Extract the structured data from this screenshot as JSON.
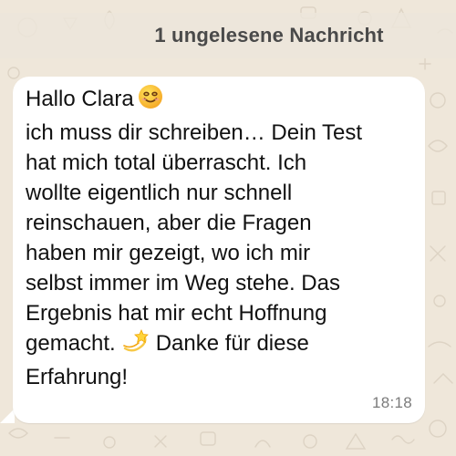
{
  "banner": {
    "unread_label": "1 ungelesene Nachricht"
  },
  "message": {
    "lines": [
      "Hallo Clara",
      "ich muss dir schreiben… Dein Test",
      "hat mich total überrascht. Ich",
      "wollte eigentlich nur schnell",
      "reinschauen, aber die Fragen",
      "haben mir gezeigt, wo ich mir",
      "selbst immer im Weg stehe. Das",
      "Ergebnis hat mir echt Hoffnung",
      "gemacht.",
      "Danke für diese",
      "Erfahrung!"
    ],
    "timestamp": "18:18",
    "emoji_1": "smiling-face-icon",
    "emoji_2": "dizzy-star-icon"
  },
  "colors": {
    "wallpaper": "#efe7da",
    "bubble": "#ffffff",
    "text": "#111111",
    "timestamp": "#7b7b7b",
    "banner_text": "#4a4a4a"
  }
}
